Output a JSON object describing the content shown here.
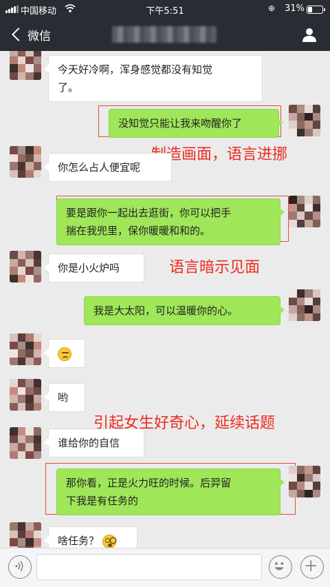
{
  "status_bar": {
    "carrier": "中国移动",
    "time": "下午5:51",
    "battery": "31%",
    "battery_level": 0.31
  },
  "nav": {
    "back_label": "微信",
    "contact_name_blurred": true
  },
  "messages": [
    {
      "side": "in",
      "lines": [
        "今天好冷啊，浑身感觉都没有知觉",
        "了。"
      ]
    },
    {
      "side": "out",
      "lines": [
        "没知觉只能让我来吻醒你了"
      ]
    },
    {
      "side": "in",
      "lines": [
        "你怎么占人便宜呢"
      ]
    },
    {
      "side": "out",
      "lines": [
        "要是跟你一起出去逛街，你可以把手",
        "揣在我兜里，保你暖暖和和的。"
      ]
    },
    {
      "side": "in",
      "lines": [
        "你是小火炉吗"
      ]
    },
    {
      "side": "out",
      "lines": [
        "我是大太阳，可以温暖你的心。"
      ]
    },
    {
      "side": "in",
      "emoji": "sweat-face-icon"
    },
    {
      "side": "in",
      "lines": [
        "哟"
      ]
    },
    {
      "side": "in",
      "lines": [
        "谁给你的自信"
      ]
    },
    {
      "side": "out",
      "lines": [
        "那你看，正是火力旺的时候。后羿留",
        "下我是有任务的"
      ]
    },
    {
      "side": "in",
      "lines": [
        "啥任务？"
      ],
      "emoji": "flushed-face-icon"
    }
  ],
  "annotations": {
    "a1": "制造画面，语言进挪",
    "a2": "语言暗示见面",
    "a3": "引起女生好奇心，延续话题"
  },
  "colors": {
    "header": "#292c33",
    "background": "#ebebeb",
    "outgoing_bubble": "#9fe659",
    "incoming_bubble": "#ffffff",
    "annotation": "#ee2a1f"
  }
}
